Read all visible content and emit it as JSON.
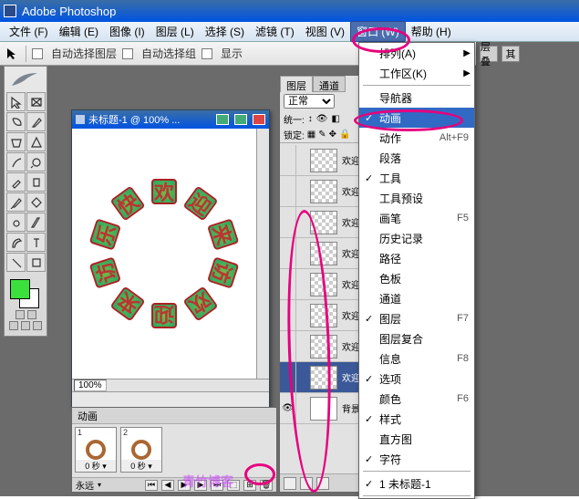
{
  "titlebar": {
    "title": "Adobe Photoshop"
  },
  "menu": {
    "file": "文件 (F)",
    "edit": "编辑 (E)",
    "image": "图像 (I)",
    "layer": "图层 (L)",
    "select": "选择 (S)",
    "filter": "滤镜 (T)",
    "view": "视图 (V)",
    "window": "窗口 (W)",
    "help": "帮助 (H)"
  },
  "options": {
    "auto_select_layer": "自动选择图层",
    "auto_select_group": "自动选择组",
    "show": "显示"
  },
  "right_toolbar": {
    "stack": "层叠",
    "other": "其"
  },
  "document": {
    "title": "未标题-1 @ 100% ...",
    "zoom": "100%",
    "ring_chars": [
      "欢",
      "迎",
      "来",
      "访",
      "欢",
      "迎",
      "来",
      "访",
      "乐",
      "快"
    ]
  },
  "animation": {
    "title": "动画",
    "frames": [
      {
        "num": "1",
        "duration": "0 秒 ▾"
      },
      {
        "num": "2",
        "duration": "0 秒 ▾"
      }
    ],
    "loop": "永远"
  },
  "layers_panel": {
    "tabs": {
      "layers": "图层",
      "channels": "通道"
    },
    "mode": "正常",
    "unify": "统一:",
    "lock": "锁定:",
    "rows": [
      {
        "name": "欢迎来",
        "sel": false
      },
      {
        "name": "欢迎来",
        "sel": false
      },
      {
        "name": "欢迎来",
        "sel": false
      },
      {
        "name": "欢迎来",
        "sel": false
      },
      {
        "name": "欢迎来",
        "sel": false
      },
      {
        "name": "欢迎来",
        "sel": false
      },
      {
        "name": "欢迎来",
        "sel": false
      },
      {
        "name": "欢迎来",
        "sel": true
      },
      {
        "name": "背景",
        "sel": false,
        "bg": true
      }
    ]
  },
  "window_menu": {
    "items": [
      {
        "label": "排列(A)",
        "arrow": true
      },
      {
        "label": "工作区(K)",
        "arrow": true
      },
      {
        "sep": true
      },
      {
        "label": "导航器"
      },
      {
        "label": "动画",
        "checked": true,
        "hl": true
      },
      {
        "label": "动作",
        "shortcut": "Alt+F9"
      },
      {
        "label": "段落"
      },
      {
        "label": "工具",
        "checked": true
      },
      {
        "label": "工具预设"
      },
      {
        "label": "画笔",
        "shortcut": "F5"
      },
      {
        "label": "历史记录"
      },
      {
        "label": "路径"
      },
      {
        "label": "色板"
      },
      {
        "label": "通道"
      },
      {
        "label": "图层",
        "checked": true,
        "shortcut": "F7"
      },
      {
        "label": "图层复合"
      },
      {
        "label": "信息",
        "shortcut": "F8"
      },
      {
        "label": "选项",
        "checked": true
      },
      {
        "label": "颜色",
        "shortcut": "F6"
      },
      {
        "label": "样式",
        "checked": true
      },
      {
        "label": "直方图"
      },
      {
        "label": "字符",
        "checked": true
      },
      {
        "sep": true
      },
      {
        "label": "1 未标题-1",
        "checked": true
      },
      {
        "sep": true
      }
    ]
  },
  "watermark": "青竹博客"
}
